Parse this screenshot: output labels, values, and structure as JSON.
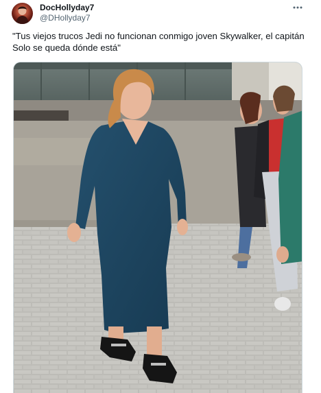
{
  "author": {
    "display_name": "DocHollyday7",
    "handle": "@DHollyday7"
  },
  "tweet": {
    "text": "\"Tus viejos trucos Jedi no funcionan conmigo joven Skywalker, el capitán Solo se queda dónde está\""
  },
  "icons": {
    "more": "more-horizontal-icon",
    "avatar": "avatar"
  },
  "media": {
    "kind": "photo",
    "colors": {
      "pavement": "#b9b8b3",
      "dress": "#1f4a66",
      "wall": "#5d6a66"
    }
  }
}
